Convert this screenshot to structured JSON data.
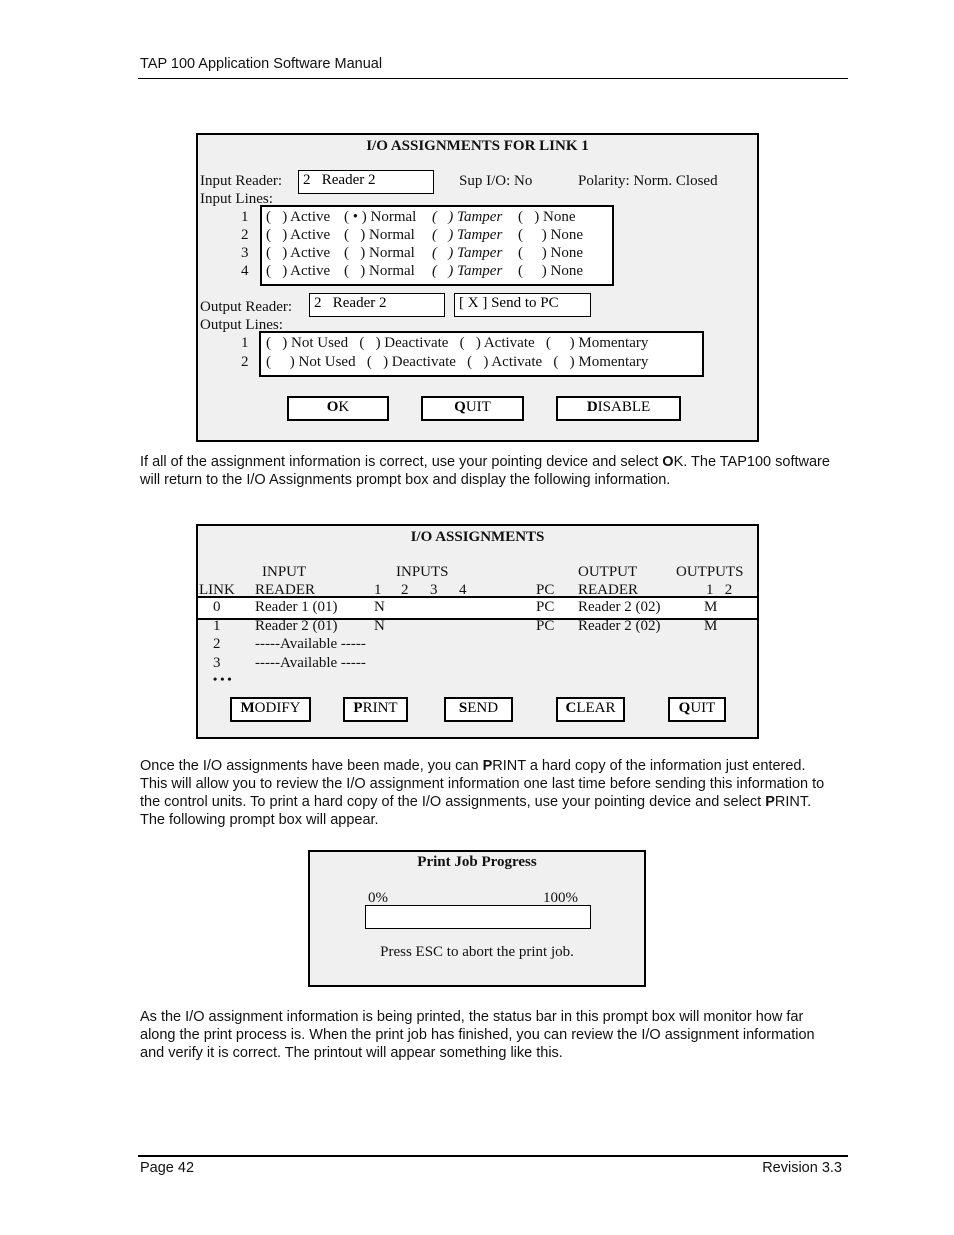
{
  "header": {
    "title": "TAP 100 Application Software Manual"
  },
  "footer": {
    "page": "Page 42",
    "revision": "Revision 3.3"
  },
  "dialog1": {
    "title": "I/O ASSIGNMENTS FOR LINK 1",
    "input_reader_label": "Input Reader:",
    "input_reader_value": "2   Reader 2",
    "sup_io": "Sup I/O: No",
    "polarity": "Polarity: Norm. Closed",
    "input_lines_label": "Input Lines:",
    "input_lines": [
      {
        "num": "1",
        "active": "(   ) Active",
        "normal": "( • ) Normal",
        "tamper": "(   ) Tamper",
        "none": "(   ) None",
        "selected": "Normal"
      },
      {
        "num": "2",
        "active": "(   ) Active",
        "normal": "(   ) Normal",
        "tamper": "(   ) Tamper",
        "none": "(     ) None",
        "selected": ""
      },
      {
        "num": "3",
        "active": "(   ) Active",
        "normal": "(   ) Normal",
        "tamper": "(   ) Tamper",
        "none": "(     ) None",
        "selected": ""
      },
      {
        "num": "4",
        "active": "(   ) Active",
        "normal": "(   ) Normal",
        "tamper": "(   ) Tamper",
        "none": "(     ) None",
        "selected": ""
      }
    ],
    "output_reader_label": "Output Reader:",
    "output_reader_value": "2   Reader 2",
    "send_to_pc": "[ X ] Send to PC",
    "send_to_pc_checked": true,
    "output_lines_label": "Output Lines:",
    "output_lines": [
      {
        "num": "1",
        "text": "(   ) Not Used   (   ) Deactivate   (   ) Activate   (     ) Momentary"
      },
      {
        "num": "2",
        "text": "(     ) Not Used   (   ) Deactivate   (   ) Activate   (   ) Momentary"
      }
    ],
    "buttons": [
      {
        "hot": "O",
        "rest": "K"
      },
      {
        "hot": "Q",
        "rest": "UIT"
      },
      {
        "hot": "D",
        "rest": "ISABLE"
      }
    ]
  },
  "para1": {
    "before": "If all of the assignment information is correct, use your pointing device and select ",
    "hot": "O",
    "after": "K. The TAP100 software will return to the I/O Assignments prompt box and display the following information."
  },
  "dialog2": {
    "title": "I/O ASSIGNMENTS",
    "headers": {
      "input_top": "INPUT",
      "inputs_top": "INPUTS",
      "output_top": "OUTPUT",
      "outputs_top": "OUTPUTS",
      "link": "LINK",
      "reader": "READER",
      "in1": "1",
      "in2": "2",
      "in3": "3",
      "in4": "4",
      "pc": "PC",
      "out_reader": "READER",
      "out12": "1   2"
    },
    "rows": [
      {
        "link": "0",
        "reader": "Reader 1 (01)",
        "inputs": "N",
        "pc": "PC",
        "out_reader": "Reader 2 (02)",
        "outputs": "M",
        "selected": true
      },
      {
        "link": "1",
        "reader": "Reader 2 (01)",
        "inputs": "N",
        "pc": "PC",
        "out_reader": "Reader 2 (02)",
        "outputs": "M",
        "selected": false
      },
      {
        "link": "2",
        "reader": "-----Available -----",
        "inputs": "",
        "pc": "",
        "out_reader": "",
        "outputs": "",
        "selected": false
      },
      {
        "link": "3",
        "reader": "-----Available -----",
        "inputs": "",
        "pc": "",
        "out_reader": "",
        "outputs": "",
        "selected": false
      }
    ],
    "ellipsis": "• • •",
    "buttons": [
      {
        "hot": "M",
        "rest": "ODIFY"
      },
      {
        "hot": "P",
        "rest": "RINT"
      },
      {
        "hot": "S",
        "rest": "END"
      },
      {
        "hot": "C",
        "rest": "LEAR"
      },
      {
        "hot": "Q",
        "rest": "UIT"
      }
    ]
  },
  "para2": {
    "s1": "Once the I/O assignments have been made, you can ",
    "hot1": "P",
    "s2": "RINT a hard copy of the information just entered. This will allow you to review the I/O assignment information one last time before sending this information to the control units. To print a hard copy of the I/O assignments, use your pointing device and select ",
    "hot2": "P",
    "s3": "RINT. The following prompt box will appear."
  },
  "dialog3": {
    "title": "Print Job Progress",
    "min_label": "0%",
    "max_label": "100%",
    "progress_percent": 0,
    "hint": "Press ESC to abort the print job."
  },
  "para3": {
    "text": "As the I/O assignment information is being printed, the status bar in this prompt box will monitor how far along the print process is. When the print job has finished, you can review the I/O assignment information and verify it is correct. The printout will appear something like this."
  }
}
